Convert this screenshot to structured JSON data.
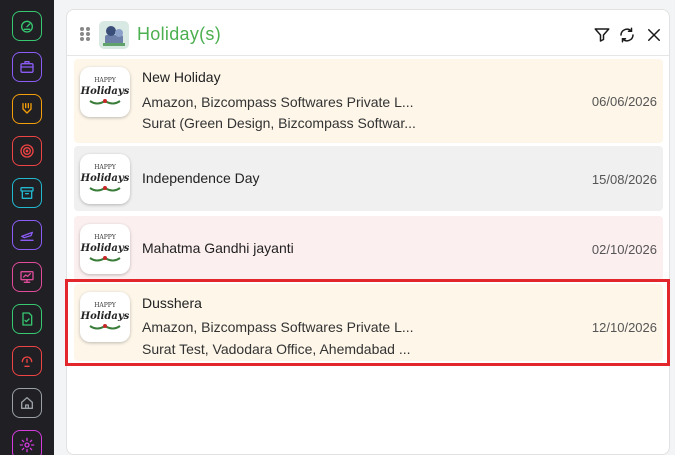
{
  "sidebar": {
    "items": [
      {
        "icon": "dashboard-icon",
        "color": "#37c871"
      },
      {
        "icon": "briefcase-icon",
        "color": "#8b5cf6"
      },
      {
        "icon": "hands-icon",
        "color": "#f59e0b"
      },
      {
        "icon": "target-icon",
        "color": "#ef4444"
      },
      {
        "icon": "archive-icon",
        "color": "#22b8cf"
      },
      {
        "icon": "plane-icon",
        "color": "#8b5cf6"
      },
      {
        "icon": "monitor-icon",
        "color": "#e04c9b"
      },
      {
        "icon": "document-icon",
        "color": "#37c871"
      },
      {
        "icon": "headset-icon",
        "color": "#ef4444"
      },
      {
        "icon": "home-icon",
        "color": "#9aa0a6"
      },
      {
        "icon": "gear-icon",
        "color": "#d63be0"
      }
    ]
  },
  "panel": {
    "title": "Holiday(s)",
    "title_color": "#4caf50",
    "header_icons": [
      "filter-icon",
      "refresh-icon",
      "close-icon"
    ]
  },
  "holidays": [
    {
      "thumb_text": [
        "HAPPY",
        "Holidays"
      ],
      "title": "New Holiday",
      "companies": "Amazon, Bizcompass Softwares Private L...",
      "locations": "Surat (Green Design, Bizcompass Softwar...",
      "date": "06/06/2026",
      "bg": "#fdf6e9"
    },
    {
      "thumb_text": [
        "HAPPY",
        "Holidays"
      ],
      "title": "Independence Day",
      "date": "15/08/2026",
      "bg": "#f0f0f0"
    },
    {
      "thumb_text": [
        "HAPPY",
        "Holidays"
      ],
      "title": "Mahatma Gandhi jayanti",
      "date": "02/10/2026",
      "bg": "#fcefef"
    },
    {
      "thumb_text": [
        "HAPPY",
        "Holidays"
      ],
      "title": "Dusshera",
      "companies": "Amazon, Bizcompass Softwares Private L...",
      "locations": "Surat Test, Vadodara Office, Ahemdabad ...",
      "date": "12/10/2026",
      "bg": "#fdf6e9"
    }
  ],
  "highlight_color": "#e3262c"
}
